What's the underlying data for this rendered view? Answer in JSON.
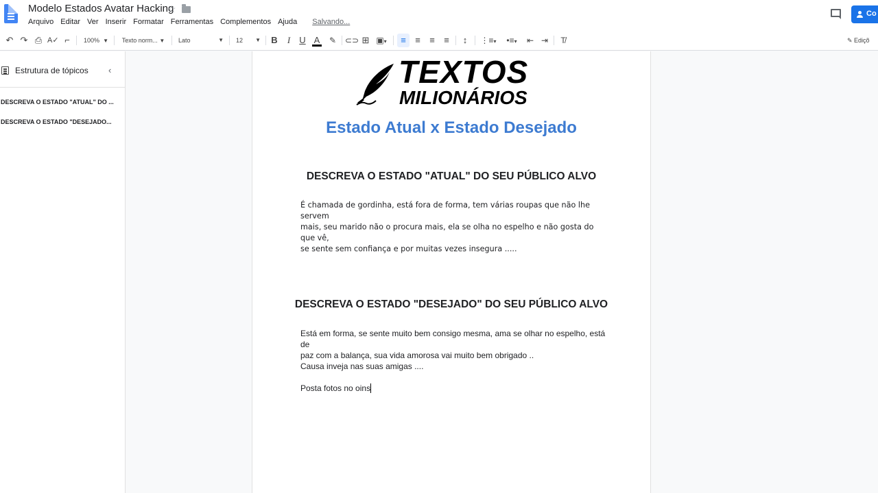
{
  "app": {
    "doc_title": "Modelo Estados Avatar Hacking",
    "menu": [
      "Arquivo",
      "Editar",
      "Ver",
      "Inserir",
      "Formatar",
      "Ferramentas",
      "Complementos",
      "Ajuda"
    ],
    "status": "Salvando...",
    "share_label": "Co"
  },
  "toolbar": {
    "zoom": "100%",
    "style": "Texto norm...",
    "font": "Lato",
    "size": "12",
    "mode": "Ediçõ"
  },
  "outline": {
    "title": "Estrutura de tópicos",
    "items": [
      "DESCREVA O ESTADO \"ATUAL\" DO ...",
      "DESCREVA O ESTADO \"DESEJADO..."
    ]
  },
  "document": {
    "logo_line1": "TEXTOS",
    "logo_line2": "MILIONÁRIOS",
    "heading": "Estado Atual x Estado Desejado",
    "section1_title": "DESCREVA O ESTADO \"ATUAL\" DO SEU PÚBLICO ALVO",
    "section1_lines": [
      "É chamada de gordinha, está  fora de forma, tem várias roupas que não lhe servem",
      "mais, seu marido não o procura mais, ela se olha no espelho e não gosta do que vê,",
      "se sente sem confiança e por muitas vezes insegura ....."
    ],
    "section2_title": "DESCREVA O ESTADO \"DESEJADO\" DO SEU PÚBLICO ALVO",
    "section2_lines": [
      "Está em forma, se sente muito bem consigo mesma,  ama se olhar no espelho, está de",
      "paz com a balança, sua vida amorosa vai muito bem obrigado .."
    ],
    "para2": "Causa inveja nas suas amigas ....",
    "para3": "Posta fotos no oins"
  }
}
